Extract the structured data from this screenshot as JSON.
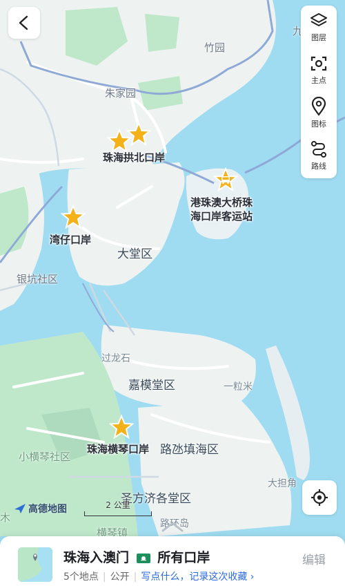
{
  "colors": {
    "water": "#9fdcf1",
    "land": "#f2f5f4",
    "green": "#b9e6c7",
    "road": "#cfd9e3",
    "highway": "#8fa9d6",
    "star": "#f4b21a",
    "link": "#2a6ae0"
  },
  "toolbar": {
    "back_icon": "chevron-left-icon",
    "layers": {
      "label": "图层",
      "icon": "layers-icon"
    },
    "poi": {
      "label": "主点",
      "icon": "focus-icon"
    },
    "marker": {
      "label": "图标",
      "icon": "pin-icon"
    },
    "route": {
      "label": "路线",
      "icon": "route-icon"
    },
    "locate_icon": "crosshair-icon"
  },
  "map_labels": {
    "zhujiayuan": "朱家园",
    "zhuyuan": "竹园",
    "jiu": "九",
    "datang": "大堂区",
    "yinkeng": "银坑社区",
    "guolongshi": "过龙石",
    "jiamotang": "嘉模堂区",
    "yilimi": "一粒米",
    "xiaohengqin": "小横琴社区",
    "ludian": "路氹填海区",
    "shengfangji": "圣方济各堂区",
    "dadanjiao": "大担角",
    "luhuandao": "路环岛",
    "hengqinzhen": "横琴镇",
    "mu": "木"
  },
  "ports": [
    {
      "name": "珠海拱北口岸"
    },
    {
      "name": "湾仔口岸"
    },
    {
      "name": "港珠澳大桥珠海口岸客运站",
      "line1": "港珠澳大桥珠",
      "line2": "海口岸客运站"
    },
    {
      "name": "珠海横琴口岸"
    }
  ],
  "map_footer": {
    "logo_text": "高德地图",
    "scale_text": "2 公里"
  },
  "sheet": {
    "title": "珠海入澳门",
    "title_flag": "macau-flag-icon",
    "title_suffix": "所有口岸",
    "count": "5个地点",
    "visibility": "公开",
    "prompt": "写点什么，记录这次收藏 ›",
    "edit": "编辑"
  }
}
